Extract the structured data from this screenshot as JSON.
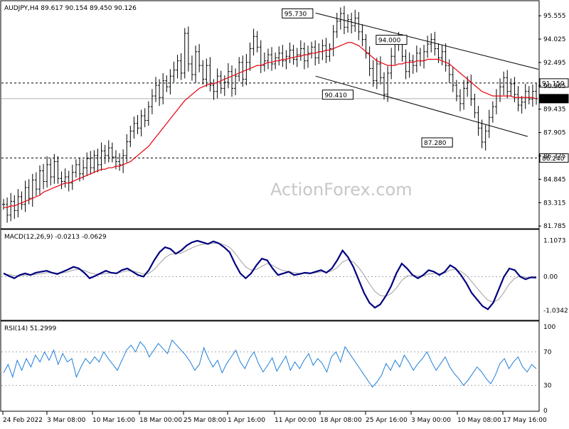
{
  "chart_data": [
    {
      "type": "candlestick",
      "title": "AUDJPY,H4  89.617 90.154 89.450 90.126",
      "watermark": "ActionForex.com",
      "ylim": [
        81.7,
        96.4
      ],
      "yticks": [
        "95.555",
        "94.025",
        "92.495",
        "90.965",
        "89.435",
        "87.905",
        "86.375",
        "84.845",
        "83.315",
        "81.785"
      ],
      "ytick_values": [
        95.555,
        94.025,
        92.495,
        90.965,
        89.435,
        87.905,
        86.375,
        84.845,
        83.315,
        81.785
      ],
      "xtick_labels": [
        "24 Feb 2022",
        "3 Mar 08:00",
        "10 Mar 16:00",
        "18 Mar 00:00",
        "25 Mar 08:00",
        "1 Apr 16:00",
        "11 Apr 00:00",
        "18 Apr 08:00",
        "25 Apr 16:00",
        "3 May 00:00",
        "10 May 08:00",
        "17 May 16:00"
      ],
      "close_path": [
        83.2,
        82.5,
        83.4,
        82.8,
        83.7,
        83.2,
        84.3,
        83.6,
        84.8,
        84.2,
        85.4,
        84.7,
        85.8,
        85.0,
        86.0,
        84.9,
        84.7,
        85.0,
        84.6,
        85.3,
        85.8,
        85.2,
        85.6,
        86.2,
        85.6,
        86.4,
        85.8,
        86.7,
        86.4,
        86.9,
        86.3,
        86.0,
        85.8,
        86.4,
        87.3,
        88.0,
        88.5,
        88.2,
        89.0,
        88.7,
        89.6,
        90.3,
        91.0,
        90.2,
        91.3,
        90.9,
        91.6,
        92.0,
        92.6,
        91.8,
        94.4,
        92.4,
        91.7,
        93.2,
        92.3,
        91.4,
        92.3,
        91.0,
        90.6,
        91.6,
        90.8,
        91.2,
        91.9,
        90.8,
        91.6,
        92.5,
        91.4,
        92.5,
        93.4,
        94.2,
        93.5,
        92.3,
        92.6,
        93.0,
        92.4,
        92.8,
        93.1,
        92.6,
        92.9,
        93.3,
        92.7,
        93.0,
        93.4,
        92.6,
        93.1,
        93.5,
        92.8,
        93.2,
        93.6,
        92.9,
        93.4,
        94.5,
        95.2,
        95.7,
        94.8,
        95.3,
        94.9,
        95.4,
        94.5,
        94.0,
        93.1,
        92.1,
        91.3,
        92.4,
        91.5,
        90.41,
        91.8,
        92.9,
        93.7,
        94.0,
        92.9,
        91.9,
        92.6,
        92.3,
        93.1,
        92.6,
        93.2,
        93.7,
        94.0,
        93.4,
        92.8,
        93.2,
        92.3,
        91.7,
        91.0,
        90.3,
        89.8,
        90.8,
        91.2,
        90.1,
        89.2,
        88.2,
        87.28,
        88.0,
        88.9,
        89.6,
        90.3,
        90.9,
        91.5,
        90.6,
        91.1,
        90.4,
        89.7,
        89.9,
        90.6,
        90.1,
        90.6,
        90.126
      ],
      "series": [
        {
          "name": "MA",
          "values": [
            83.0,
            83.0,
            83.1,
            83.1,
            83.2,
            83.3,
            83.4,
            83.5,
            83.6,
            83.7,
            83.8,
            84.0,
            84.1,
            84.2,
            84.3,
            84.4,
            84.5,
            84.6,
            84.6,
            84.7,
            84.8,
            84.9,
            85.0,
            85.1,
            85.2,
            85.3,
            85.4,
            85.5,
            85.5,
            85.6,
            85.6,
            85.7,
            85.7,
            85.8,
            85.9,
            86.0,
            86.2,
            86.4,
            86.6,
            86.8,
            87.0,
            87.3,
            87.6,
            87.9,
            88.2,
            88.5,
            88.8,
            89.1,
            89.4,
            89.7,
            90.0,
            90.2,
            90.4,
            90.6,
            90.8,
            90.9,
            91.0,
            91.1,
            91.1,
            91.2,
            91.3,
            91.4,
            91.5,
            91.6,
            91.7,
            91.8,
            91.9,
            92.0,
            92.1,
            92.2,
            92.3,
            92.3,
            92.4,
            92.5,
            92.5,
            92.6,
            92.6,
            92.7,
            92.7,
            92.8,
            92.8,
            92.9,
            92.9,
            93.0,
            93.0,
            93.1,
            93.1,
            93.2,
            93.2,
            93.3,
            93.3,
            93.4,
            93.5,
            93.6,
            93.7,
            93.8,
            93.8,
            93.7,
            93.6,
            93.4,
            93.2,
            93.0,
            92.8,
            92.6,
            92.5,
            92.4,
            92.3,
            92.3,
            92.3,
            92.4,
            92.4,
            92.5,
            92.5,
            92.5,
            92.6,
            92.6,
            92.6,
            92.7,
            92.7,
            92.7,
            92.7,
            92.6,
            92.5,
            92.4,
            92.2,
            92.0,
            91.8,
            91.6,
            91.4,
            91.2,
            91.0,
            90.8,
            90.6,
            90.5,
            90.4,
            90.3,
            90.3,
            90.3,
            90.3,
            90.3,
            90.3,
            90.2,
            90.2,
            90.2,
            90.2,
            90.2,
            90.2,
            90.1
          ]
        }
      ],
      "hlines": [
        {
          "value": 91.15,
          "label": "91.150",
          "style": "dashed"
        },
        {
          "value": 90.126,
          "label": "90.126",
          "style": "solid"
        },
        {
          "value": 86.24,
          "label": "86.240",
          "style": "dashed"
        }
      ],
      "channel": {
        "upper": {
          "from": [
            0.585,
            95.73
          ],
          "to": [
            1.0,
            92.05
          ]
        },
        "lower": {
          "from": [
            0.585,
            91.6
          ],
          "to": [
            0.98,
            87.65
          ]
        }
      },
      "annotations": [
        {
          "text": "95.730",
          "x": 0.58,
          "y": 95.73
        },
        {
          "text": "94.000",
          "x": 0.755,
          "y": 94.0
        },
        {
          "text": "90.410",
          "x": 0.655,
          "y": 90.41
        },
        {
          "text": "87.280",
          "x": 0.84,
          "y": 87.28
        }
      ]
    },
    {
      "type": "line",
      "title": "MACD(12,26,9) -0.0213 -0.0629",
      "ylim": [
        -1.25,
        1.25
      ],
      "yticks": [
        "1.1073",
        "0.00",
        "-1.0342"
      ],
      "ytick_values": [
        1.1073,
        0.0,
        -1.0342
      ],
      "series": [
        {
          "name": "MACD",
          "values": [
            0.1,
            0.02,
            -0.05,
            0.05,
            0.1,
            0.05,
            0.12,
            0.15,
            0.18,
            0.12,
            0.08,
            0.15,
            0.22,
            0.3,
            0.25,
            0.12,
            -0.05,
            0.02,
            0.1,
            0.18,
            0.12,
            0.1,
            0.2,
            0.25,
            0.15,
            0.05,
            0.0,
            0.2,
            0.5,
            0.75,
            0.9,
            0.85,
            0.7,
            0.8,
            0.95,
            1.05,
            1.1,
            1.05,
            1.0,
            1.08,
            1.02,
            0.9,
            0.75,
            0.4,
            0.1,
            -0.05,
            0.1,
            0.35,
            0.55,
            0.5,
            0.25,
            0.05,
            0.1,
            0.15,
            0.05,
            0.08,
            0.12,
            0.1,
            0.15,
            0.2,
            0.12,
            0.25,
            0.5,
            0.8,
            0.6,
            0.3,
            -0.1,
            -0.5,
            -0.8,
            -0.95,
            -0.85,
            -0.6,
            -0.3,
            0.1,
            0.4,
            0.25,
            0.05,
            -0.05,
            0.05,
            0.2,
            0.15,
            0.05,
            0.15,
            0.35,
            0.25,
            0.05,
            -0.2,
            -0.5,
            -0.7,
            -0.9,
            -1.0,
            -0.8,
            -0.4,
            0.0,
            0.25,
            0.2,
            0.0,
            -0.08,
            -0.02,
            -0.02
          ]
        },
        {
          "name": "Signal",
          "values": [
            0.08,
            0.06,
            0.03,
            0.03,
            0.05,
            0.05,
            0.07,
            0.09,
            0.12,
            0.12,
            0.11,
            0.12,
            0.15,
            0.2,
            0.22,
            0.19,
            0.12,
            0.08,
            0.07,
            0.1,
            0.11,
            0.11,
            0.14,
            0.18,
            0.17,
            0.13,
            0.08,
            0.1,
            0.22,
            0.4,
            0.58,
            0.68,
            0.7,
            0.72,
            0.8,
            0.88,
            0.95,
            0.99,
            1.0,
            1.02,
            1.02,
            0.98,
            0.9,
            0.72,
            0.5,
            0.3,
            0.2,
            0.22,
            0.32,
            0.4,
            0.35,
            0.25,
            0.18,
            0.16,
            0.12,
            0.1,
            0.1,
            0.1,
            0.12,
            0.15,
            0.14,
            0.17,
            0.28,
            0.45,
            0.52,
            0.45,
            0.28,
            0.05,
            -0.22,
            -0.45,
            -0.58,
            -0.6,
            -0.52,
            -0.35,
            -0.12,
            0.02,
            0.05,
            0.02,
            0.02,
            0.08,
            0.1,
            0.09,
            0.11,
            0.2,
            0.22,
            0.16,
            0.04,
            -0.15,
            -0.35,
            -0.55,
            -0.72,
            -0.78,
            -0.7,
            -0.48,
            -0.22,
            -0.05,
            0.02,
            -0.02,
            -0.04,
            -0.06
          ]
        }
      ]
    },
    {
      "type": "line",
      "title": "RSI(14) 51.2999",
      "ylim": [
        0,
        100
      ],
      "yticks": [
        "100",
        "70",
        "30",
        "0"
      ],
      "ytick_values": [
        100,
        70,
        30,
        0
      ],
      "guides": [
        70,
        30
      ],
      "series": [
        {
          "name": "RSI",
          "values": [
            45,
            55,
            40,
            60,
            48,
            62,
            52,
            66,
            58,
            70,
            60,
            72,
            55,
            68,
            58,
            62,
            40,
            52,
            62,
            56,
            64,
            58,
            70,
            62,
            55,
            48,
            60,
            72,
            78,
            70,
            82,
            76,
            64,
            72,
            80,
            74,
            68,
            84,
            78,
            72,
            66,
            58,
            48,
            55,
            75,
            62,
            52,
            60,
            45,
            56,
            64,
            72,
            58,
            50,
            62,
            70,
            56,
            46,
            54,
            63,
            47,
            56,
            65,
            48,
            58,
            50,
            60,
            68,
            54,
            62,
            56,
            46,
            64,
            70,
            58,
            76,
            68,
            60,
            52,
            44,
            36,
            28,
            34,
            42,
            56,
            48,
            60,
            52,
            66,
            58,
            48,
            56,
            62,
            70,
            58,
            48,
            56,
            64,
            52,
            44,
            38,
            30,
            36,
            44,
            52,
            46,
            38,
            32,
            42,
            56,
            62,
            50,
            58,
            64,
            52,
            46,
            55,
            50
          ]
        }
      ]
    }
  ]
}
